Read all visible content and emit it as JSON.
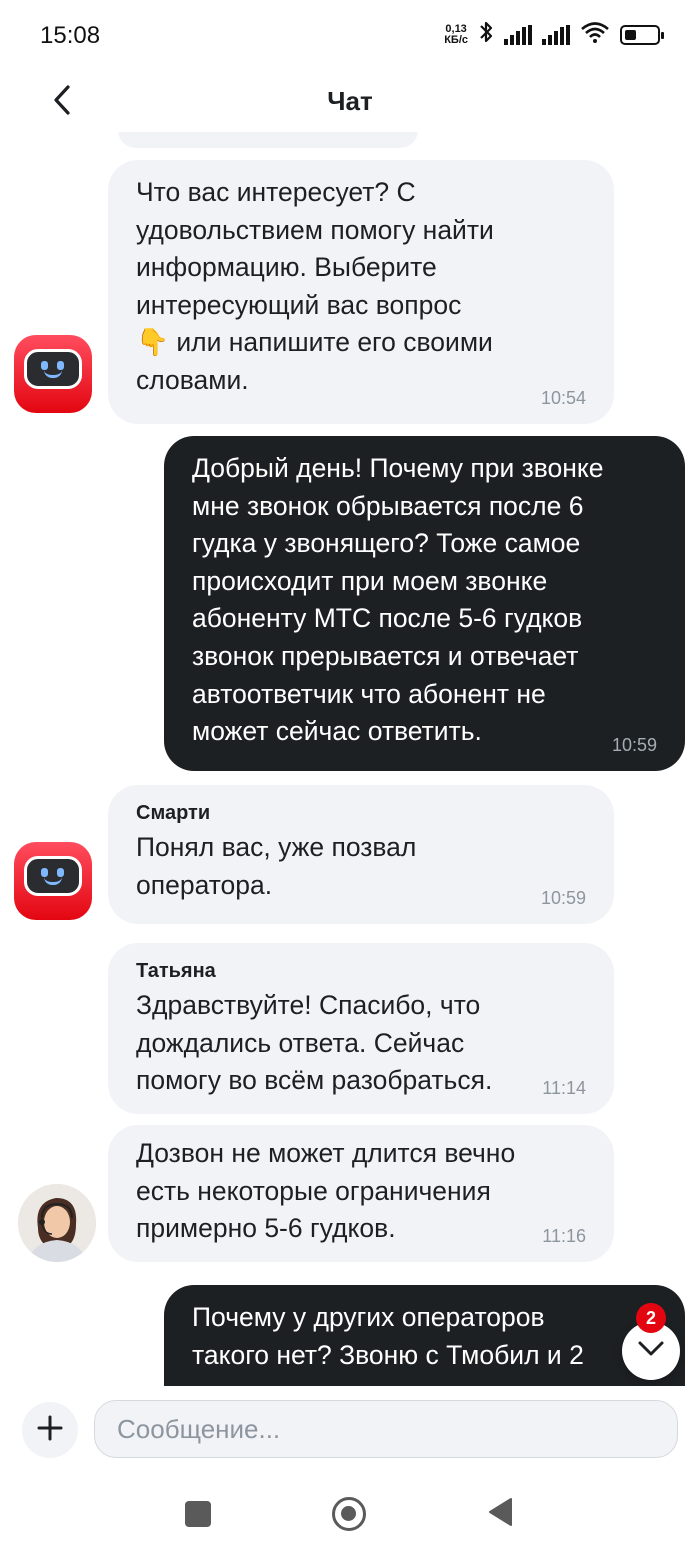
{
  "status_bar": {
    "time": "15:08",
    "net_speed_value": "0,13",
    "net_speed_unit": "КБ/с",
    "battery_level": 0.35,
    "icons": [
      "bluetooth-icon",
      "signal-icon",
      "signal-icon",
      "wifi-icon",
      "battery-icon"
    ]
  },
  "header": {
    "title": "Чат",
    "back_icon": "chevron-left-icon"
  },
  "messages": [
    {
      "direction": "incoming",
      "author": "",
      "text_before_emoji": "Что вас интересует? С\nудовольствием помогу найти\nинформацию. Выберите\nинтересующий вас вопрос\n",
      "emoji": "👇",
      "text_after_emoji": " или напишите его своими\nсловами.",
      "time": "10:54",
      "avatar": "bot-avatar"
    },
    {
      "direction": "outgoing",
      "text": "Добрый день! Почему при звонке\nмне звонок обрывается после 6\nгудка у звонящего? Тоже самое\nпроисходит при моем звонке\nабоненту МТС после 5-6 гудков\nзвонок прерывается и отвечает\nавтоответчик что абонент не\nможет сейчас ответить.",
      "time": "10:59"
    },
    {
      "direction": "incoming",
      "author": "Смарти",
      "text": "Понял вас, уже позвал\nоператора.",
      "time": "10:59",
      "avatar": "bot-avatar"
    },
    {
      "direction": "incoming",
      "author": "Татьяна",
      "text": "Здравствуйте! Спасибо, что\nдождались ответа. Сейчас\nпомогу во всём разобраться.",
      "time": "11:14"
    },
    {
      "direction": "incoming",
      "author": "",
      "text": "Дозвон не может длится вечно\nесть некоторые ограничения\nпримерно 5-6 гудков.",
      "time": "11:16",
      "avatar": "operator-avatar"
    },
    {
      "direction": "outgoing",
      "text": "Почему у других операторов\nтакого нет? Звоню с Тмобил и 2",
      "time": ""
    }
  ],
  "scroll_down": {
    "unread_count": "2",
    "icon": "chevron-down-icon"
  },
  "composer": {
    "placeholder": "Сообщение...",
    "value": "",
    "add_icon": "plus-icon"
  },
  "nav_bar": {
    "icons": [
      "recents-square-icon",
      "home-circle-icon",
      "back-triangle-icon"
    ]
  },
  "colors": {
    "incoming_bubble": "#f2f3f7",
    "outgoing_bubble": "#1d2023",
    "accent_red": "#e30611",
    "timestamp": "#8d969f"
  }
}
